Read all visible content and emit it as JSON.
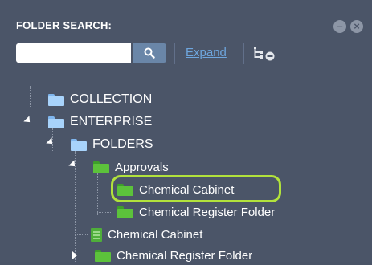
{
  "header": {
    "title": "FOLDER SEARCH:",
    "minimize_icon": "minus-circle-icon",
    "close_icon": "close-circle-icon"
  },
  "search": {
    "value": "",
    "placeholder": "",
    "button_icon": "search-icon"
  },
  "toolbar": {
    "expand_label": "Expand",
    "tree_toggle_icon": "tree-collapse-icon"
  },
  "tree": {
    "collection": "COLLECTION",
    "enterprise": "ENTERPRISE",
    "folders": "FOLDERS",
    "approvals": "Approvals",
    "approvals_children": [
      "Chemical Cabinet",
      "Chemical Register Folder"
    ],
    "root_items": [
      "Chemical Cabinet",
      "Chemical Register Folder"
    ],
    "selected": "Chemical Cabinet"
  },
  "colors": {
    "panel_bg": "#4b5568",
    "link": "#6ea6de",
    "highlight": "#b2e23c",
    "folder_blue": "#a8d3fb",
    "folder_green": "#5cc23b"
  }
}
